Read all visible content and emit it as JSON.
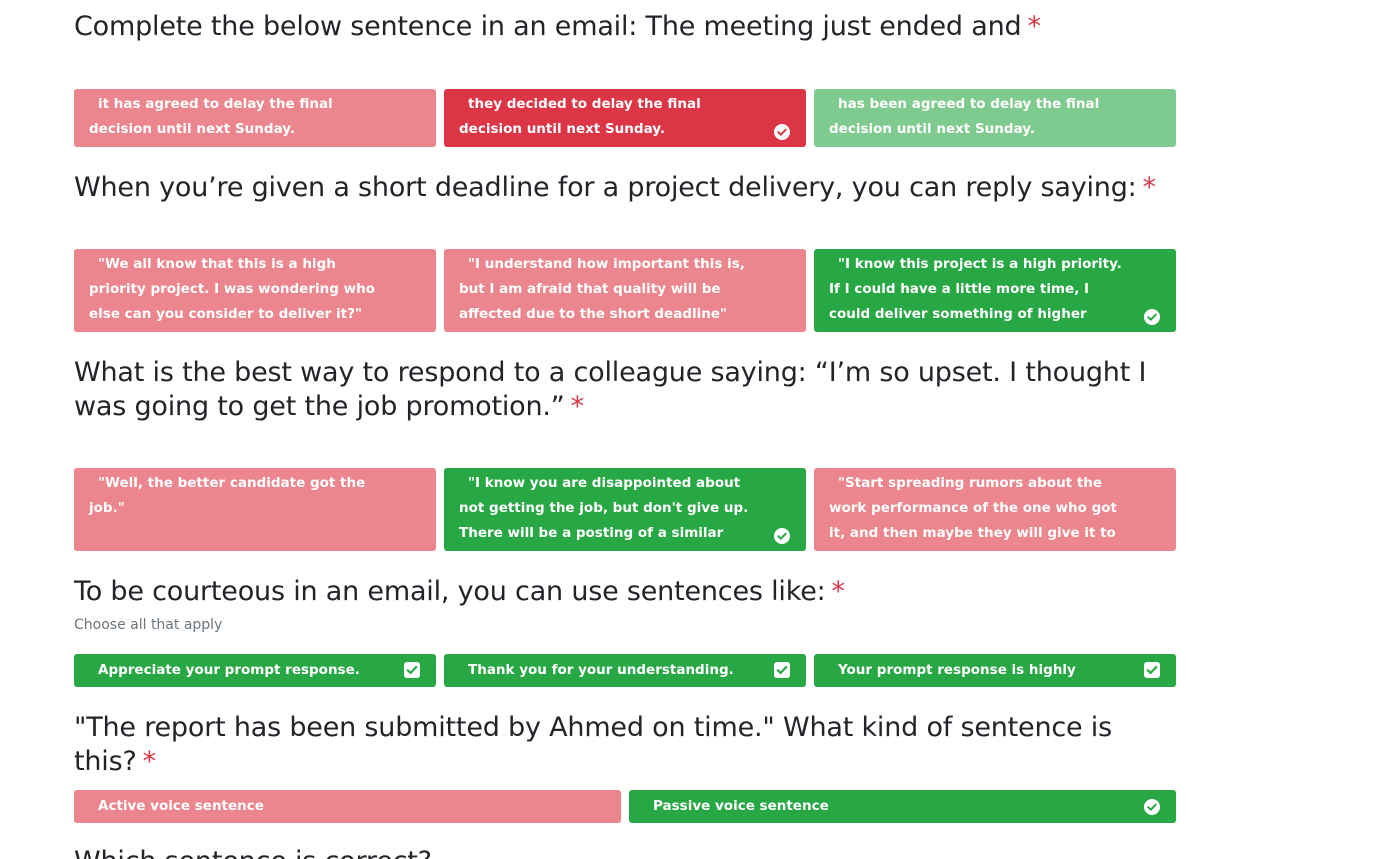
{
  "q1": {
    "title": "Complete the below sentence in an email: The meeting just ended and",
    "required": "*",
    "options": [
      {
        "label": "it has agreed to delay the final decision until next Sunday."
      },
      {
        "label": "they decided to delay the final decision until next Sunday."
      },
      {
        "label": "has been agreed to delay the final decision until next Sunday."
      }
    ]
  },
  "q2": {
    "title": "When you’re given a short deadline for a project delivery, you can reply saying:",
    "required": "*",
    "options": [
      {
        "label": "\"We all know that this is a high priority project. I was wondering who else can you consider to deliver it?\""
      },
      {
        "label": "\"I understand how important this is, but I am afraid that quality will be affected due to the short deadline\""
      },
      {
        "label": "\"I know this project is a high priority. If I could have a little more time, I could deliver something of higher quality\""
      }
    ]
  },
  "q3": {
    "title": "What is the best way to respond to a colleague saying: “I’m so upset. I thought I was going to get the job promotion.”",
    "required": "*",
    "options": [
      {
        "label": "\"Well, the better candidate got the job.\""
      },
      {
        "label": "\"I know you are disappointed about not getting the job, but don't give up. There will be a posting of a similar position next week, apply for it.\""
      },
      {
        "label": "\"Start spreading rumors about the work performance of the one who got it, and then maybe they will give it to you.\""
      }
    ]
  },
  "q4": {
    "title": "To be courteous in an email, you can use sentences like:",
    "required": "*",
    "hint": "Choose all that apply",
    "options": [
      {
        "label": "Appreciate your prompt response."
      },
      {
        "label": "Thank you for your understanding."
      },
      {
        "label": "Your prompt response is highly appreciated."
      }
    ]
  },
  "q5": {
    "title": "\"The report has been submitted by Ahmed on time.\" What kind of sentence is this?",
    "required": "*",
    "options": [
      {
        "label": "Active voice sentence"
      },
      {
        "label": "Passive voice sentence"
      }
    ]
  },
  "q6": {
    "title": "Which sentence is correct?"
  },
  "colors": {
    "wrong": "#eb868e",
    "wrong_selected": "#dc3545",
    "correct_selected": "#28a745",
    "correct_unselected": "#7fcb8f",
    "required": "#dc3545"
  }
}
